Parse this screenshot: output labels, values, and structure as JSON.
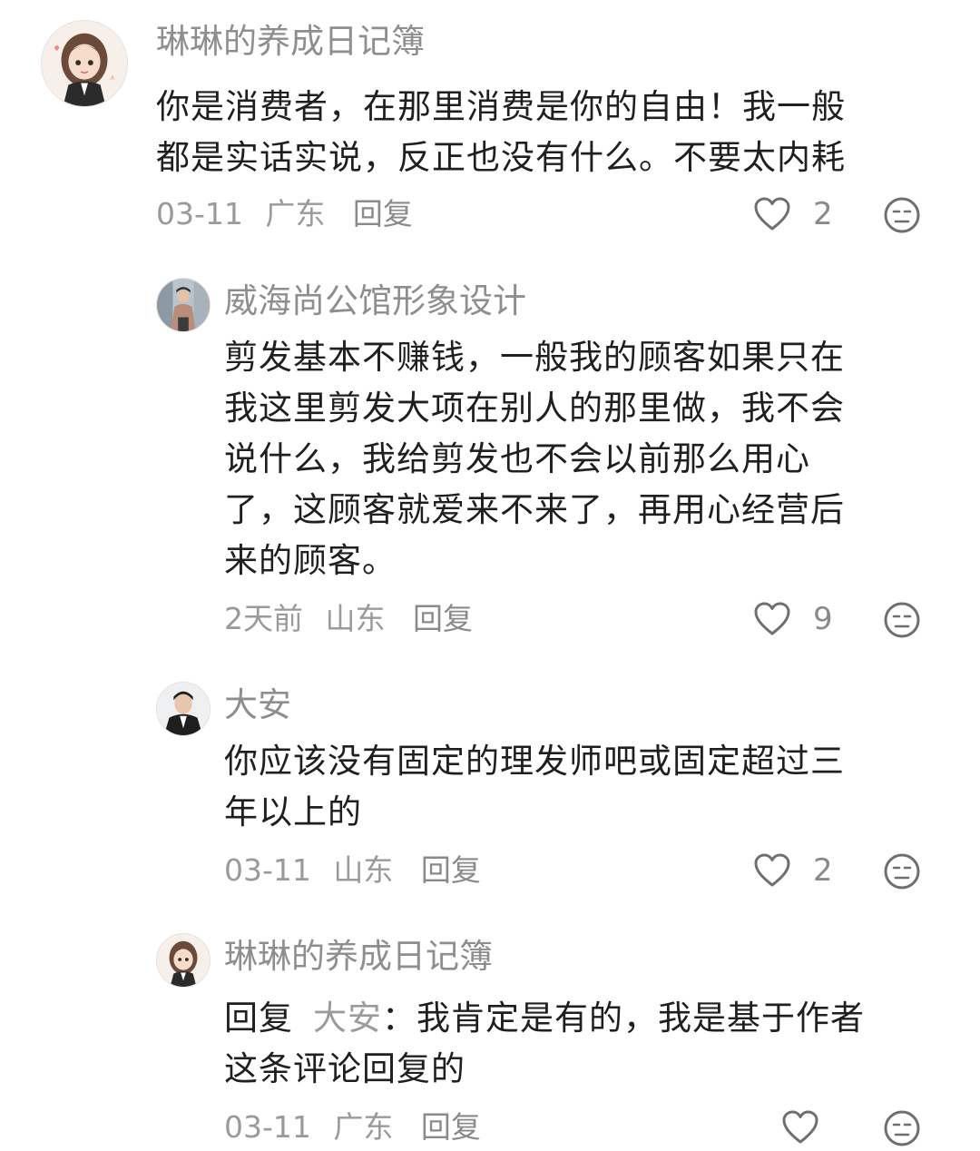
{
  "comments": [
    {
      "username": "琳琳的养成日记簿",
      "avatar_icon": "girl-avatar",
      "lines": [
        "你是消费者，在那里消费是你的自由！我一般",
        "都是实话实说，反正也没有什么。不要太内耗"
      ],
      "date": "03-11",
      "location": "广东",
      "reply_label": "回复",
      "like_count": "2"
    },
    {
      "username": "威海尚公馆形象设计",
      "avatar_icon": "man-photo-avatar",
      "lines": [
        "剪发基本不赚钱，一般我的顾客如果只在",
        "我这里剪发大项在别人的那里做，我不会",
        "说什么，我给剪发也不会以前那么用心",
        "了，这顾客就爱来不来了，再用心经营后",
        "来的顾客。"
      ],
      "date": "2天前",
      "location": "山东",
      "reply_label": "回复",
      "like_count": "9"
    },
    {
      "username": "大安",
      "avatar_icon": "man-suit-avatar",
      "lines": [
        "你应该没有固定的理发师吧或固定超过三",
        "年以上的"
      ],
      "date": "03-11",
      "location": "山东",
      "reply_label": "回复",
      "like_count": "2"
    },
    {
      "username": "琳琳的养成日记簿",
      "avatar_icon": "girl-avatar",
      "reply_prefix": "回复",
      "reply_target": "大安",
      "lines": [
        "：我肯定是有的，我是基于作者",
        "这条评论回复的"
      ],
      "date": "03-11",
      "location": "广东",
      "reply_label": "回复",
      "like_count": ""
    }
  ],
  "icons": {
    "like": "heart-outline-icon",
    "dislike": "meh-face-icon"
  },
  "colors": {
    "text": "#1f1f1f",
    "muted": "#8e8e8e",
    "icon": "#6f6f6f"
  }
}
